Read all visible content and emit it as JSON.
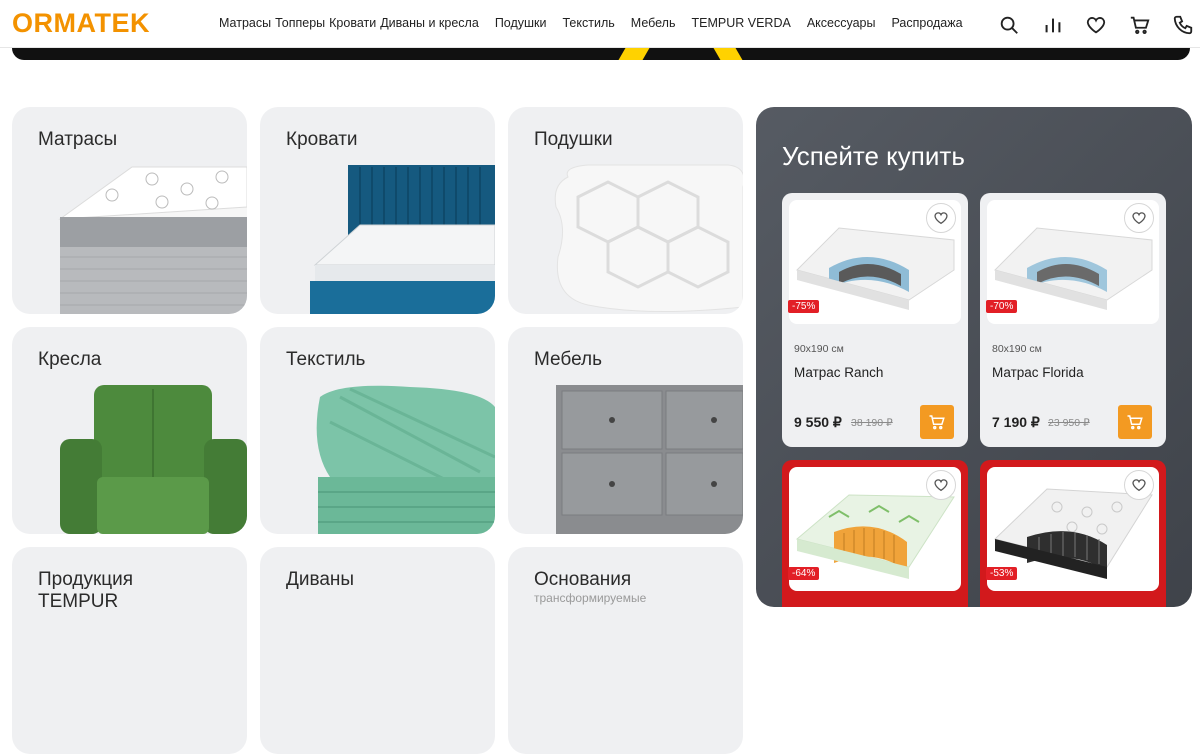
{
  "brand": {
    "logo": "ORMATEK",
    "accent": "#f39200"
  },
  "nav": [
    "Матрасы",
    "Топперы",
    "Кровати",
    "Диваны и кресла",
    "Подушки",
    "Текстиль",
    "Мебель",
    "TEMPUR VERDA",
    "Аксессуары",
    "Распродажа"
  ],
  "header_icons": [
    "search-icon",
    "compare-icon",
    "heart-icon",
    "cart-icon",
    "phone-icon"
  ],
  "categories": [
    {
      "title": "Матрасы",
      "sub": ""
    },
    {
      "title": "Кровати",
      "sub": ""
    },
    {
      "title": "Подушки",
      "sub": ""
    },
    {
      "title": "Кресла",
      "sub": ""
    },
    {
      "title": "Текстиль",
      "sub": ""
    },
    {
      "title": "Мебель",
      "sub": ""
    },
    {
      "title": "Продукция TEMPUR",
      "sub": ""
    },
    {
      "title": "Диваны",
      "sub": ""
    },
    {
      "title": "Основания",
      "sub": "трансформируемые"
    }
  ],
  "promo": {
    "title": "Успейте купить",
    "products": [
      {
        "badge": "-75%",
        "size": "90x190 см",
        "name": "Матрас Ranch",
        "price": "9 550 ₽",
        "old_price": "38 190 ₽",
        "highlight": false
      },
      {
        "badge": "-70%",
        "size": "80x190 см",
        "name": "Матрас Florida",
        "price": "7 190 ₽",
        "old_price": "23 950 ₽",
        "highlight": false
      },
      {
        "badge": "-64%",
        "size": "",
        "name": "",
        "price": "",
        "old_price": "",
        "highlight": true
      },
      {
        "badge": "-53%",
        "size": "",
        "name": "",
        "price": "",
        "old_price": "",
        "highlight": true
      }
    ]
  },
  "colors": {
    "tile_bg": "#eff0f2",
    "promo_bg": "#4b4f56",
    "sale_red": "#e21f26",
    "cart_orange": "#f39a22",
    "hot_card": "#d2191c"
  }
}
